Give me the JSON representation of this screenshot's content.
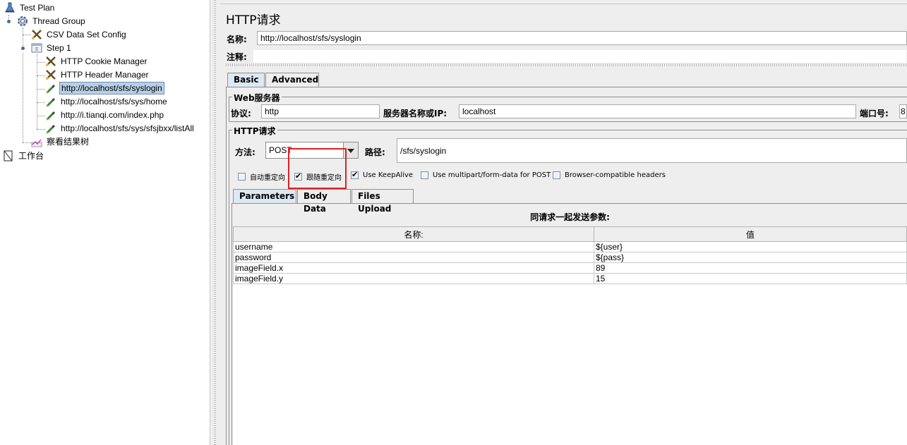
{
  "tree": {
    "items": [
      {
        "label": "Test Plan",
        "icon": "flask-icon"
      },
      {
        "label": "Thread Group",
        "icon": "gear-icon"
      },
      {
        "label": "CSV Data Set Config",
        "icon": "scissors-icon"
      },
      {
        "label": "Step 1",
        "icon": "controller-icon"
      },
      {
        "label": "HTTP Cookie Manager",
        "icon": "scissors-icon"
      },
      {
        "label": "HTTP Header Manager",
        "icon": "scissors-icon"
      },
      {
        "label": "http://localhost/sfs/syslogin",
        "icon": "pipette-icon"
      },
      {
        "label": "http://localhost/sfs/sys/home",
        "icon": "pipette-icon"
      },
      {
        "label": "http://i.tianqi.com/index.php",
        "icon": "pipette-icon"
      },
      {
        "label": "http://localhost/sfs/sys/sfsjbxx/listAll",
        "icon": "pipette-icon"
      },
      {
        "label": "察看结果树",
        "icon": "chart-icon"
      },
      {
        "label": "工作台",
        "icon": "workbench-icon"
      }
    ],
    "selected_index": 6
  },
  "panel": {
    "title": "HTTP请求",
    "name_label": "名称:",
    "name_value": "http://localhost/sfs/syslogin",
    "comment_label": "注释:",
    "comment_value": ""
  },
  "tabs": [
    {
      "label": "Basic"
    },
    {
      "label": "Advanced"
    }
  ],
  "web_server": {
    "group_title": "Web服务器",
    "protocol_label": "协议:",
    "protocol_value": "http",
    "server_label": "服务器名称或IP:",
    "server_value": "localhost",
    "port_label": "端口号:",
    "port_value": "8"
  },
  "http_request": {
    "group_title": "HTTP请求",
    "method_label": "方法:",
    "method_value": "POST",
    "path_label": "路径:",
    "path_value": "/sfs/syslogin"
  },
  "options": [
    {
      "label": "自动重定向",
      "checked": false
    },
    {
      "label": "跟随重定向",
      "checked": true
    },
    {
      "label": "Use KeepAlive",
      "checked": true
    },
    {
      "label": "Use multipart/form-data for POST",
      "checked": false
    },
    {
      "label": "Browser-compatible headers",
      "checked": false
    }
  ],
  "sub_tabs": [
    {
      "label": "Parameters"
    },
    {
      "label": "Body Data"
    },
    {
      "label": "Files Upload"
    }
  ],
  "params": {
    "caption": "同请求一起发送参数:",
    "columns": [
      "名称:",
      "值"
    ],
    "rows": [
      [
        "username",
        "${user}"
      ],
      [
        "password",
        "${pass}"
      ],
      [
        "imageField.x",
        "89"
      ],
      [
        "imageField.y",
        "15"
      ]
    ]
  },
  "colors": {
    "highlight": "#e02020",
    "selection": "#b8cfe5"
  }
}
